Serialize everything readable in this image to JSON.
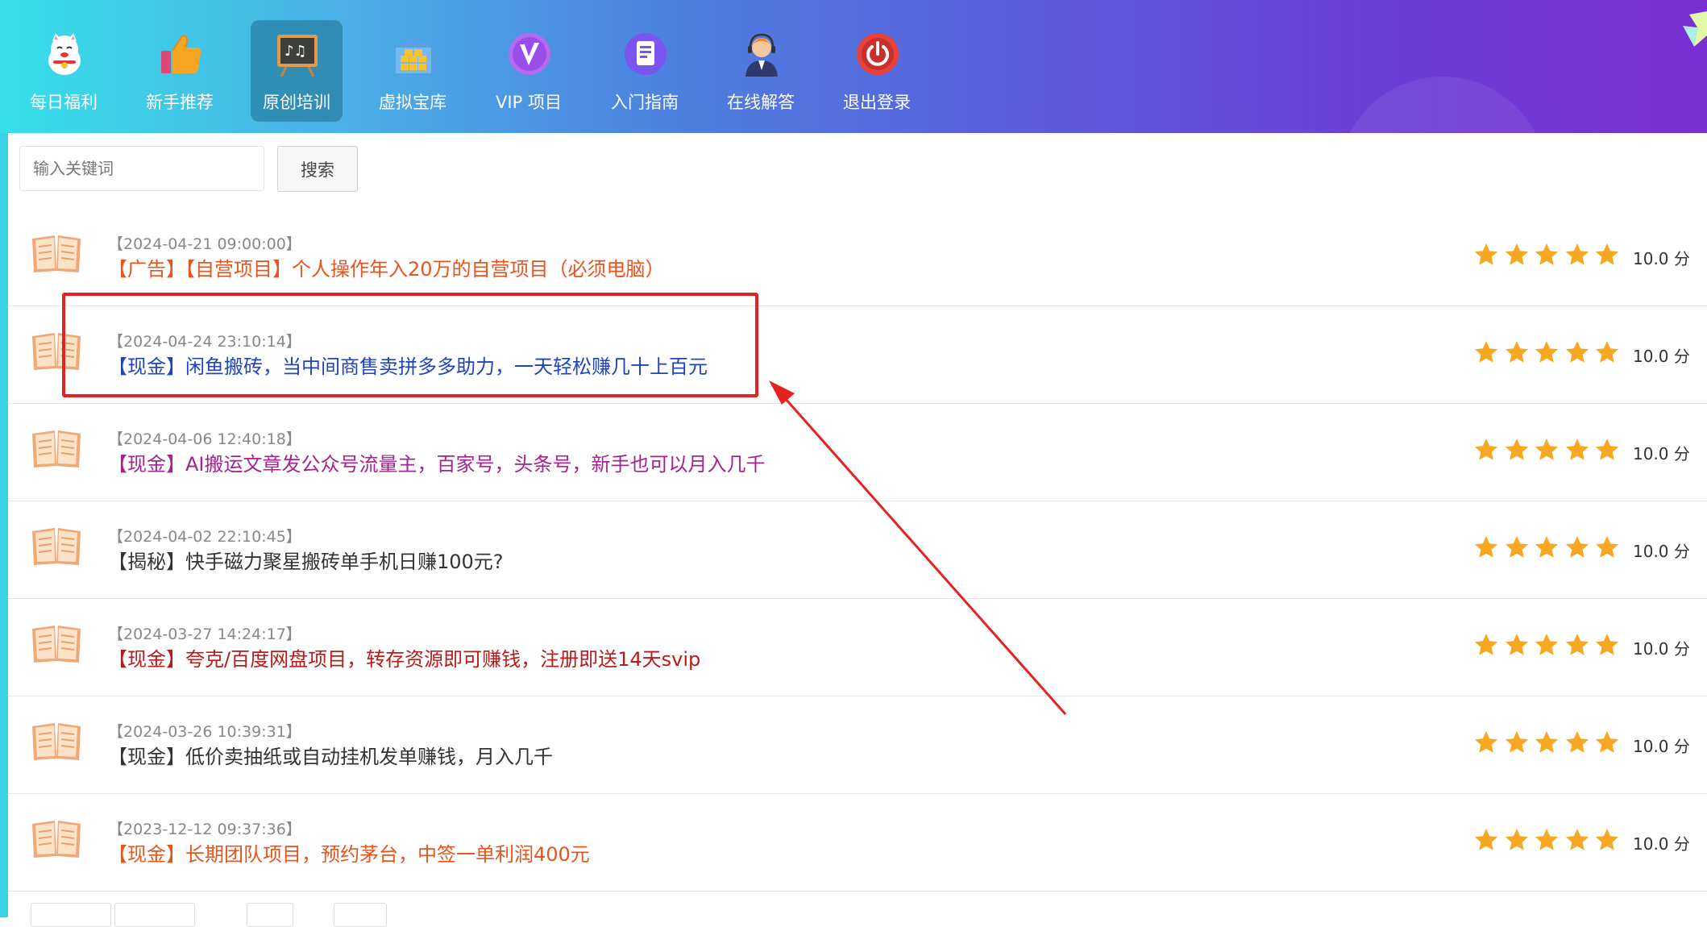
{
  "nav": {
    "items": [
      {
        "label": "每日福利",
        "icon": "lucky-cat-icon",
        "active": false
      },
      {
        "label": "新手推荐",
        "icon": "thumbs-up-icon",
        "active": false
      },
      {
        "label": "原创培训",
        "icon": "training-board-icon",
        "active": true
      },
      {
        "label": "虚拟宝库",
        "icon": "treasure-warehouse-icon",
        "active": false
      },
      {
        "label": "VIP 项目",
        "icon": "vip-badge-icon",
        "active": false
      },
      {
        "label": "入门指南",
        "icon": "document-guide-icon",
        "active": false
      },
      {
        "label": "在线解答",
        "icon": "customer-service-icon",
        "active": false
      },
      {
        "label": "退出登录",
        "icon": "power-off-icon",
        "active": false
      }
    ]
  },
  "search": {
    "placeholder": "输入关键词",
    "value": "",
    "button_label": "搜索"
  },
  "list": {
    "items": [
      {
        "date": "【2024-04-21 09:00:00】",
        "title": "【广告】【自营项目】个人操作年入20万的自营项目（必须电脑）",
        "color": "#e8541b",
        "stars": 5,
        "score": "10.0 分"
      },
      {
        "date": "【2024-04-24 23:10:14】",
        "title": "【现金】闲鱼搬砖，当中间商售卖拼多多助力，一天轻松赚几十上百元",
        "color": "#2244bb",
        "stars": 5,
        "score": "10.0 分"
      },
      {
        "date": "【2024-04-06 12:40:18】",
        "title": "【现金】AI搬运文章发公众号流量主，百家号，头条号，新手也可以月入几千",
        "color": "#a4238f",
        "stars": 5,
        "score": "10.0 分"
      },
      {
        "date": "【2024-04-02 22:10:45】",
        "title": "【揭秘】快手磁力聚星搬砖单手机日赚100元?",
        "color": "#333333",
        "stars": 5,
        "score": "10.0 分"
      },
      {
        "date": "【2024-03-27 14:24:17】",
        "title": "【现金】夸克/百度网盘项目，转存资源即可赚钱，注册即送14天svip",
        "color": "#bb1a1a",
        "stars": 5,
        "score": "10.0 分"
      },
      {
        "date": "【2024-03-26 10:39:31】",
        "title": "【现金】低价卖抽纸或自动挂机发单赚钱，月入几千",
        "color": "#333333",
        "stars": 5,
        "score": "10.0 分"
      },
      {
        "date": "【2023-12-12 09:37:36】",
        "title": "【现金】长期团队项目，预约茅台，中签一单利润400元",
        "color": "#e8541b",
        "stars": 5,
        "score": "10.0 分"
      }
    ]
  },
  "colors": {
    "star": "#f7a823",
    "annotation": "#e52222",
    "left_strip": "#3ad3e6"
  }
}
